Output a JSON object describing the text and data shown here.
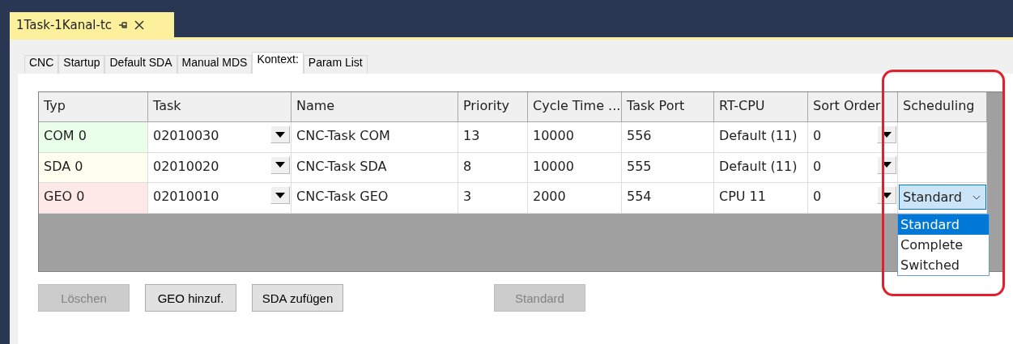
{
  "document_tab": {
    "title": "1Task-1Kanal-tc"
  },
  "tabs": [
    {
      "label": "CNC",
      "selected": false
    },
    {
      "label": "Startup",
      "selected": false
    },
    {
      "label": "Default SDA",
      "selected": false
    },
    {
      "label": "Manual MDS",
      "selected": false
    },
    {
      "label": "Kontext:",
      "selected": true
    },
    {
      "label": "Param List",
      "selected": false
    }
  ],
  "table": {
    "columns": [
      "Typ",
      "Task",
      "Name",
      "Priority",
      "Cycle Time ...",
      "Task Port",
      "RT-CPU",
      "Sort Order",
      "Scheduling"
    ],
    "rows": [
      {
        "typ": "COM 0",
        "color": "#eaffea",
        "task": "02010030",
        "name": "CNC-Task COM",
        "priority": "13",
        "cycle_time": "10000",
        "task_port": "556",
        "rt_cpu": "Default (11)",
        "sort_order": "0"
      },
      {
        "typ": "SDA 0",
        "color": "#fffff0",
        "task": "02010020",
        "name": "CNC-Task SDA",
        "priority": "8",
        "cycle_time": "10000",
        "task_port": "555",
        "rt_cpu": "Default (11)",
        "sort_order": "0"
      },
      {
        "typ": "GEO 0",
        "color": "#ffe8e8",
        "task": "02010010",
        "name": "CNC-Task GEO",
        "priority": "3",
        "cycle_time": "2000",
        "task_port": "554",
        "rt_cpu": "CPU 11",
        "sort_order": "0",
        "scheduling": {
          "value": "Standard",
          "expanded": true,
          "options": [
            {
              "label": "Standard",
              "selected": true
            },
            {
              "label": "Complete",
              "selected": false
            },
            {
              "label": "Switched",
              "selected": false
            }
          ]
        }
      }
    ]
  },
  "buttons": [
    {
      "label": "Löschen",
      "disabled": true
    },
    {
      "label": "GEO hinzuf.",
      "disabled": false
    },
    {
      "label": "SDA zufügen",
      "disabled": false
    }
  ],
  "side_buttons": [
    {
      "label": "Standard",
      "disabled": true
    }
  ]
}
